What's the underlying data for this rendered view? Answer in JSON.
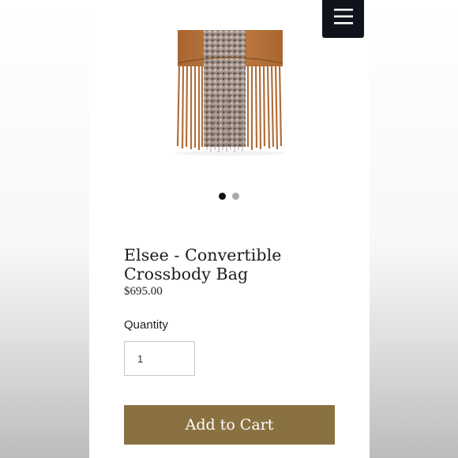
{
  "product": {
    "title": "Elsee - Convertible Crossbody Bag",
    "price": "$695.00",
    "image_alt": "Tan leather and snakeskin fringe convertible crossbody bag"
  },
  "gallery": {
    "active_index": 1,
    "total": 2
  },
  "quantity": {
    "label": "Quantity",
    "value": "1"
  },
  "cart": {
    "button_label": "Add to Cart"
  },
  "header": {
    "menu_icon": "hamburger-menu-icon"
  },
  "colors": {
    "menu_bg": "#0f141c",
    "button_bg": "#8a7141",
    "leather": "#b8743d",
    "snakeskin": "#8a7a70",
    "active_dot": "#111111",
    "inactive_dot": "#a9a9a9"
  }
}
